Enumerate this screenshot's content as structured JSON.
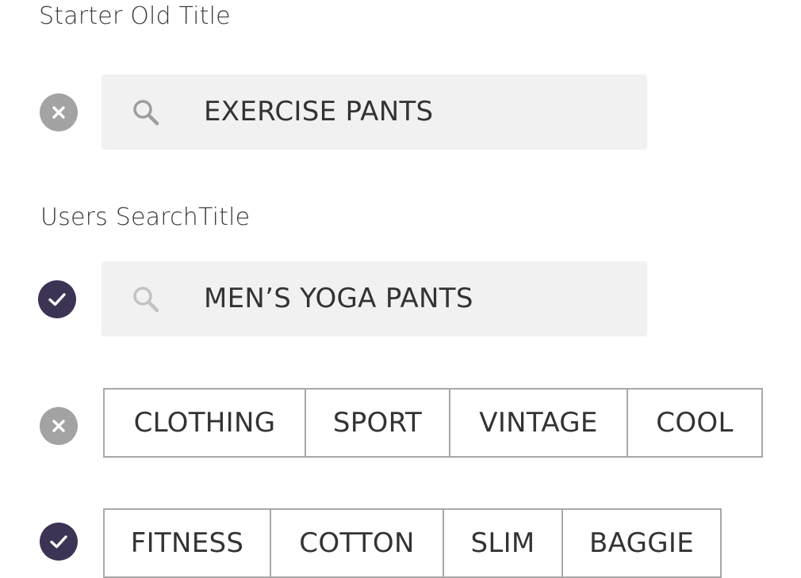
{
  "sections": {
    "starter_title": "Starter Old Title",
    "users_title": "Users SearchTitle"
  },
  "searches": [
    {
      "status": "rejected",
      "status_icon": "close-icon",
      "query": "EXERCISE PANTS",
      "icon": "search-icon"
    },
    {
      "status": "accepted",
      "status_icon": "check-icon",
      "query": "MEN’S YOGA PANTS",
      "icon": "search-icon"
    }
  ],
  "tag_groups": [
    {
      "status": "rejected",
      "status_icon": "close-icon",
      "tags": [
        "CLOTHING",
        "SPORT",
        "VINTAGE",
        "COOL"
      ]
    },
    {
      "status": "accepted",
      "status_icon": "check-icon",
      "tags": [
        "FITNESS",
        "COTTON",
        "SLIM",
        "BAGGIE"
      ]
    }
  ],
  "colors": {
    "reject": "#a3a3a3",
    "accept": "#3d3355",
    "search_bg": "#f1f1f1",
    "tag_border": "#a8a8a8",
    "text": "#333333"
  }
}
